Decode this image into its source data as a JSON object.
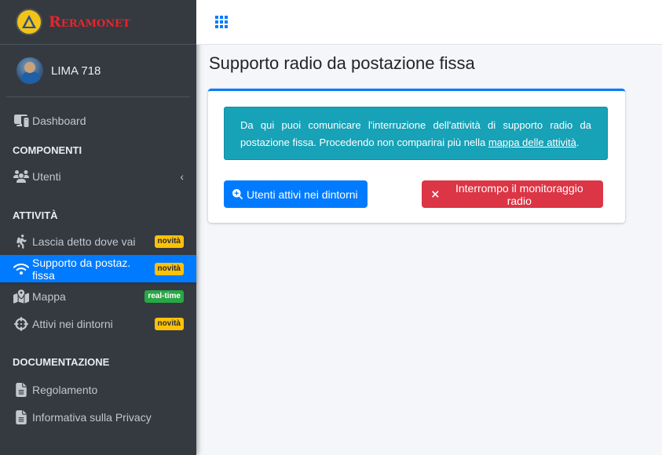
{
  "brand": {
    "name": "Reramonet"
  },
  "user": {
    "name": "LIMA 718"
  },
  "sidebar": {
    "dashboard": {
      "label": "Dashboard",
      "icon": "dashboard-icon"
    },
    "sections": [
      {
        "header": "COMPONENTI"
      },
      {
        "header": "ATTIVITÀ"
      },
      {
        "header": "DOCUMENTAZIONE"
      }
    ],
    "utenti": {
      "label": "Utenti",
      "icon": "users-icon"
    },
    "attivita": [
      {
        "label": "Lascia detto dove vai",
        "badge": "novità",
        "icon": "hiker-icon"
      },
      {
        "label": "Supporto da postaz. fissa",
        "badge": "novità",
        "icon": "wifi-icon",
        "active": true
      },
      {
        "label": "Mappa",
        "badge": "real-time",
        "icon": "map-icon"
      },
      {
        "label": "Attivi nei dintorni",
        "badge": "novità",
        "icon": "crosshairs-icon"
      }
    ],
    "documentazione": [
      {
        "label": "Regolamento",
        "icon": "file-icon"
      },
      {
        "label": "Informativa sulla Privacy",
        "icon": "file-icon"
      }
    ]
  },
  "main": {
    "title": "Supporto radio da postazione fissa",
    "callout": {
      "text": "Da qui puoi comunicare l'interruzione dell'attività di supporto radio da postazione fissa. Procedendo non comparirai più nella ",
      "link": "mappa delle attività",
      "end": "."
    },
    "buttons": {
      "nearby": "Utenti attivi nei dintorni",
      "stop": "Interrompo il monitoraggio radio"
    }
  },
  "colors": {
    "primary": "#007bff",
    "danger": "#dc3545",
    "info": "#17a2b8",
    "warning": "#ffc107",
    "success": "#28a745",
    "sidebar": "#343a40"
  }
}
